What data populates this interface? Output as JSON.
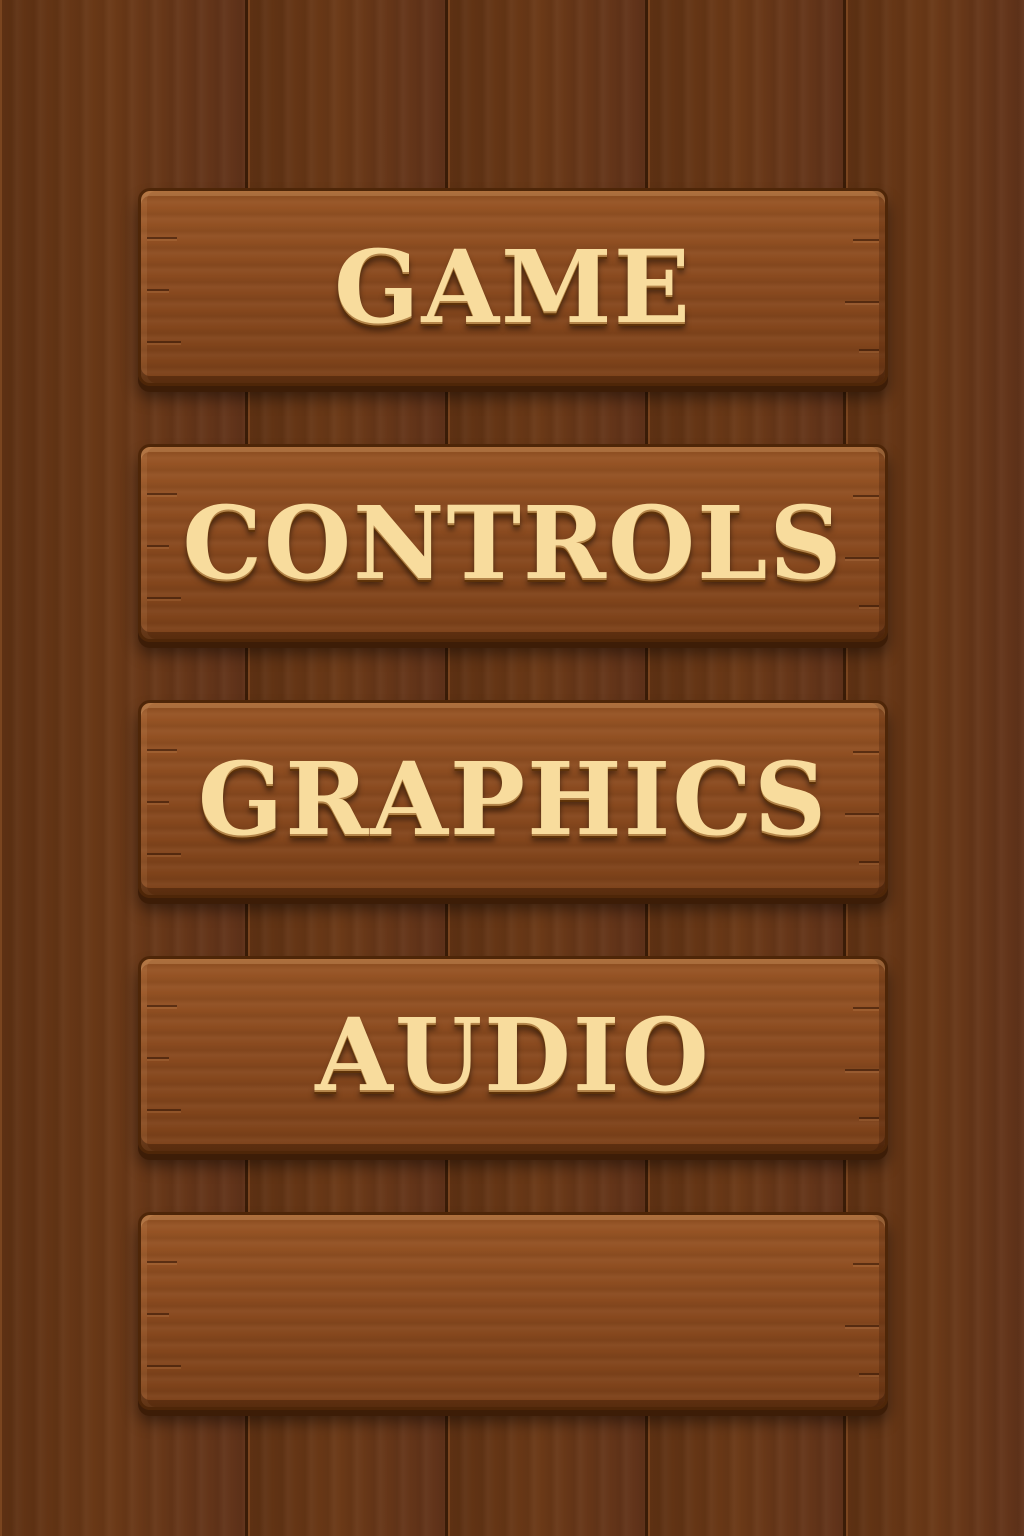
{
  "menu": {
    "items": [
      {
        "label": "GAME"
      },
      {
        "label": "CONTROLS"
      },
      {
        "label": "GRAPHICS"
      },
      {
        "label": "AUDIO"
      },
      {
        "label": ""
      }
    ]
  },
  "colors": {
    "background_wood": "#5e3113",
    "board_wood": "#8a4a1f",
    "label_text": "#f8dc9d"
  }
}
